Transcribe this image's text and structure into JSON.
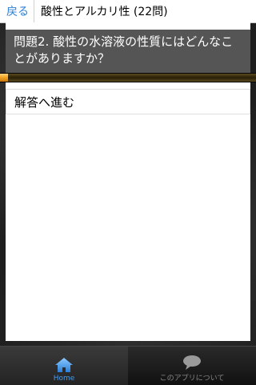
{
  "header": {
    "back_label": "戻る",
    "title": "酸性とアルカリ性 (22問)"
  },
  "question": {
    "text": "問題2. 酸性の水溶液の性質にはどんなことがありますか？"
  },
  "progress": {
    "fraction": 0.031
  },
  "answer_button": {
    "label": "解答へ進む"
  },
  "tabbar": {
    "tabs": [
      {
        "label": "Home",
        "icon": "home-icon",
        "active": true
      },
      {
        "label": "このアプリについて",
        "icon": "speech-bubble-icon",
        "active": false
      }
    ]
  },
  "colors": {
    "accent": "#2b7fd6",
    "progress": "#f0a020",
    "question_bg": "#555555"
  }
}
